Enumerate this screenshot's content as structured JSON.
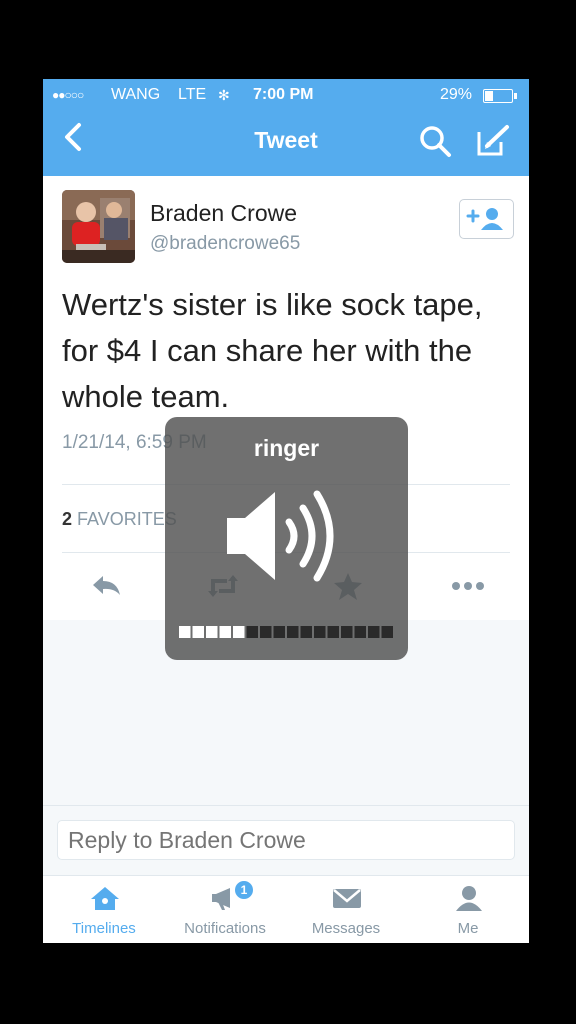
{
  "status_bar": {
    "signal": "●●○○○",
    "carrier": "WANG",
    "network": "LTE",
    "time": "7:00 PM",
    "battery": "29%",
    "battery_level": 0.29
  },
  "nav": {
    "title": "Tweet",
    "back_icon": "chevron-left-icon",
    "search_icon": "search-icon",
    "compose_icon": "compose-icon"
  },
  "tweet": {
    "name": "Braden Crowe",
    "handle": "@bradencrowe65",
    "text": "Wertz's sister is like sock tape, for $4 I can share her with the whole team.",
    "timestamp": "1/21/14, 6:59 PM",
    "favorites_count": "2",
    "favorites_label": "FAVORITES",
    "follow_icon": "add-user-icon"
  },
  "actions": [
    "reply-icon",
    "retweet-icon",
    "favorite-icon",
    "more-icon"
  ],
  "reply": {
    "placeholder": "Reply to Braden Crowe"
  },
  "tabs": [
    {
      "label": "Timelines",
      "icon": "home-icon"
    },
    {
      "label": "Notifications",
      "icon": "bell-icon",
      "badge": "1"
    },
    {
      "label": "Messages",
      "icon": "envelope-icon"
    },
    {
      "label": "Me",
      "icon": "person-icon"
    }
  ],
  "hud": {
    "label": "ringer",
    "icon": "speaker-icon",
    "volume_level": 0.31,
    "volume_segments": 16
  },
  "colors": {
    "accent": "#55acee",
    "text": "#222222",
    "muted": "#8899a6"
  }
}
